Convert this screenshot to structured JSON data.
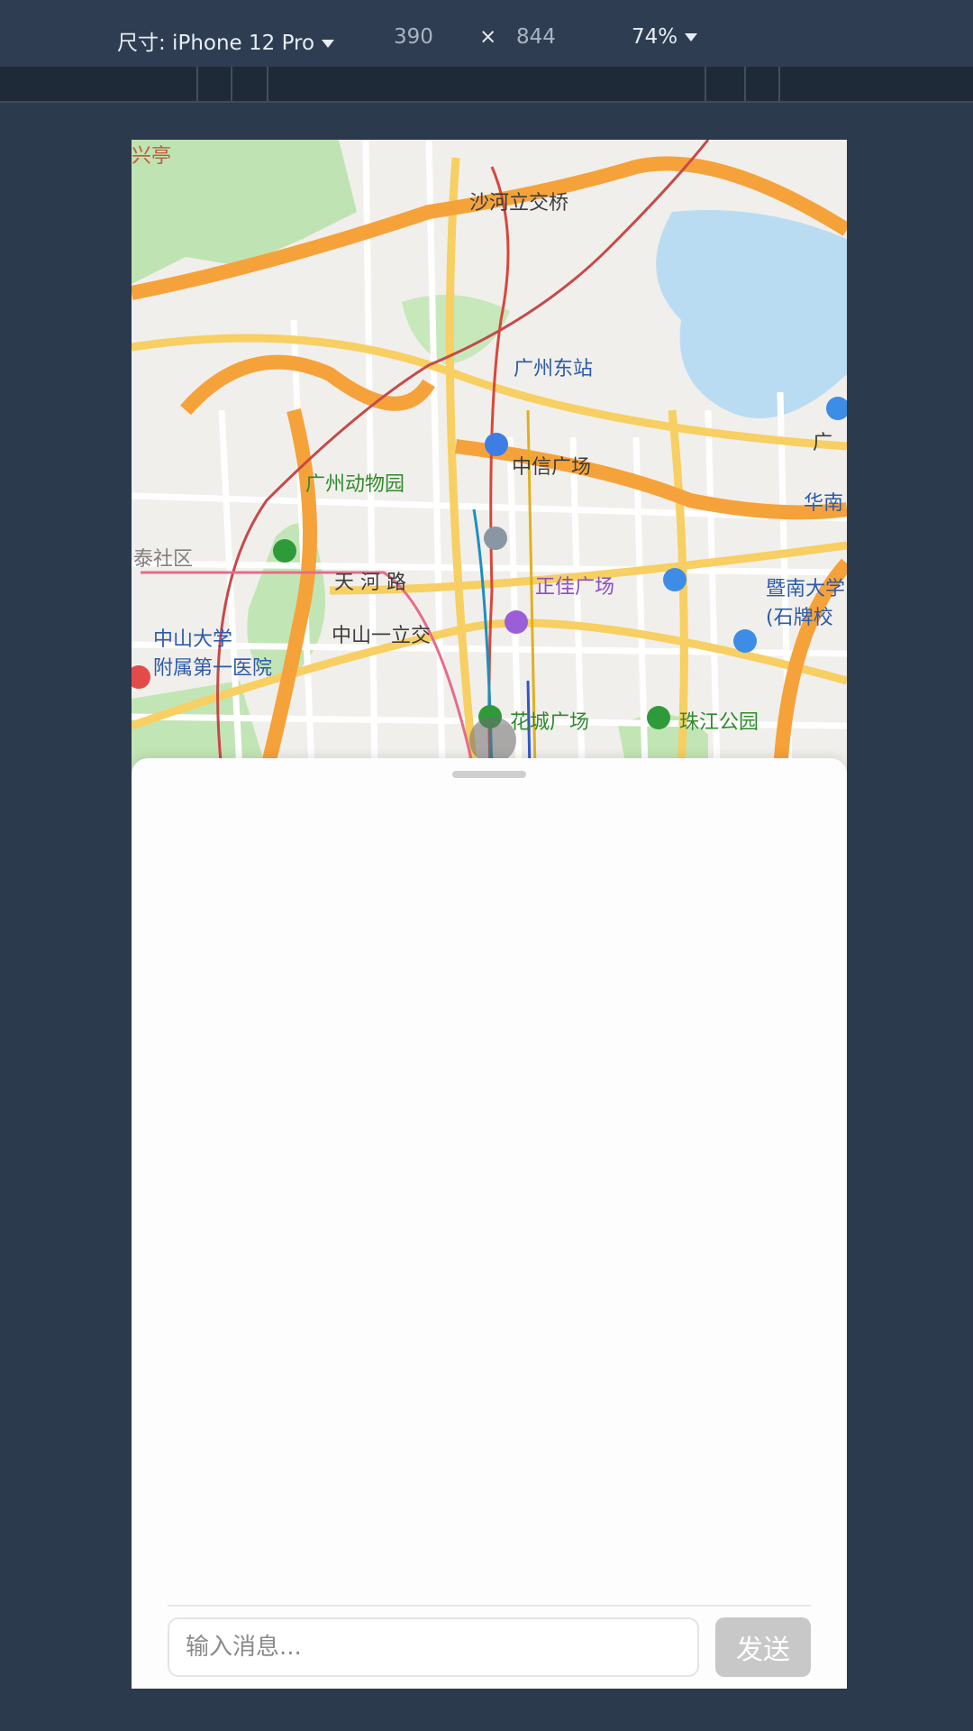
{
  "devtools": {
    "device_label": "尺寸: iPhone 12 Pro",
    "width": "390",
    "times": "×",
    "height": "844",
    "zoom": "74%"
  },
  "map": {
    "labels": {
      "shahe": "沙河立交桥",
      "dongzhan": "广州东站",
      "zhongxin": "中信广场",
      "zoo": "广州动物园",
      "huanan": "华南",
      "guang": "广",
      "taishe": "泰社区",
      "tianhe": "天 河 路",
      "zhengjia": "正佳广场",
      "jinan1": "暨南大学",
      "jinan2": "(石牌校",
      "zhongshan1": "中山大学",
      "zhongshan2": "附属第一医院",
      "zhongshanlijiao": "中山一立交",
      "huacheng": "花城广场",
      "zhujiang": "珠江公园",
      "xingting": "兴亭"
    }
  },
  "chat": {
    "placeholder": "输入消息...",
    "send_label": "发送"
  }
}
